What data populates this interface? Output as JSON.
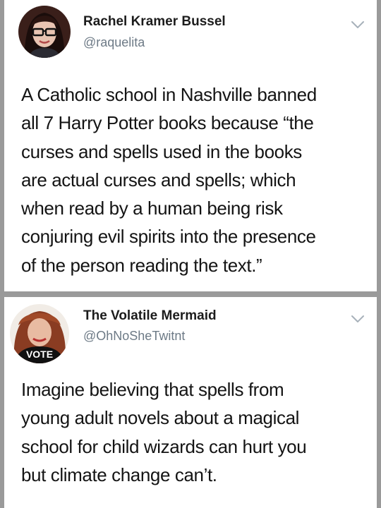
{
  "tweets": [
    {
      "display_name": "Rachel Kramer Bussel",
      "handle": "@raquelita",
      "menu_icon": "chevron-down-icon",
      "avatar_icon": "profile-photo",
      "text_lines": [
        "A Catholic school in Nashville banned",
        "all 7 Harry Potter books because “the",
        "curses and spells used in the books",
        "are actual curses and spells; which",
        "when read by a human being risk",
        "conjuring evil spirits into the presence",
        "of the person reading the text.”"
      ]
    },
    {
      "display_name": "The Volatile Mermaid",
      "handle": "@OhNoSheTwitnt",
      "menu_icon": "chevron-down-icon",
      "avatar_icon": "profile-photo",
      "avatar_shirt_text": "VOTE",
      "text_lines": [
        "Imagine believing that spells from",
        "young adult novels about a magical",
        "school for child wizards can hurt you",
        "but climate change can’t."
      ]
    }
  ],
  "colors": {
    "name": "#1c1c1c",
    "handle": "#6d7a86",
    "text": "#141414",
    "chevron": "#a7b1ba",
    "background": "#9a9a9a",
    "card": "#ffffff"
  }
}
